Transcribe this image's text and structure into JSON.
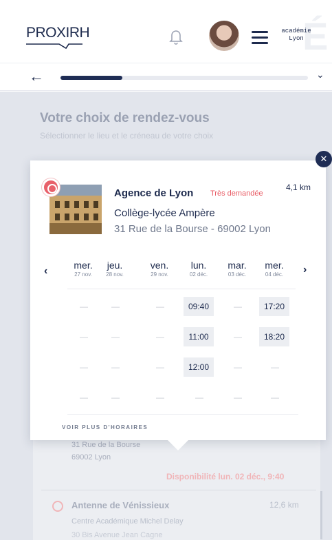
{
  "header": {
    "logo": "PROXIRH",
    "academie": [
      "académie",
      "Lyon"
    ]
  },
  "progress": {
    "value": 0.25
  },
  "background": {
    "title": "Votre choix de rendez-vous",
    "subtitle": "Sélectionner le lieu et le créneau de votre choix",
    "card_address": [
      "31 Rue de la Bourse",
      "69002 Lyon"
    ],
    "availability": "Disponibilité lun. 02 déc., 9:40",
    "next_place": {
      "name": "Antenne de Vénissieux",
      "distance": "12,6 km",
      "organization": "Centre Académique Michel Delay",
      "street": "30 Bis Avenue Jean Cagne"
    }
  },
  "popup": {
    "agency": "Agence de Lyon",
    "badge": "Très demandée",
    "distance": "4,1 km",
    "school": "Collège-lycée Ampère",
    "address": "31 Rue de la Bourse - 69002 Lyon",
    "days": [
      {
        "name": "mer.",
        "date": "27 nov."
      },
      {
        "name": "jeu.",
        "date": "28 nov."
      },
      {
        "name": "ven.",
        "date": "29 nov."
      },
      {
        "name": "lun.",
        "date": "02 déc."
      },
      {
        "name": "mar.",
        "date": "03 déc."
      },
      {
        "name": "mer.",
        "date": "04 déc."
      }
    ],
    "rows": [
      [
        "—",
        "—",
        "—",
        "09:40",
        "—",
        "17:20"
      ],
      [
        "—",
        "—",
        "—",
        "11:00",
        "—",
        "18:20"
      ],
      [
        "—",
        "—",
        "—",
        "12:00",
        "—",
        "—"
      ],
      [
        "—",
        "—",
        "—",
        "—",
        "—",
        "—"
      ]
    ],
    "more_label": "VOIR PLUS D'HORAIRES"
  },
  "icons": {
    "back": "arrow-left-icon",
    "chevron": "chevron-down-icon",
    "bell": "bell-icon",
    "menu": "hamburger-menu-icon",
    "close": "close-icon",
    "pin": "location-pin-icon",
    "prev": "chevron-left-icon",
    "next": "chevron-right-icon",
    "clock": "clock-icon"
  },
  "colors": {
    "primary": "#1f2d55",
    "accent": "#e85a63",
    "slot": "#eceef2"
  }
}
